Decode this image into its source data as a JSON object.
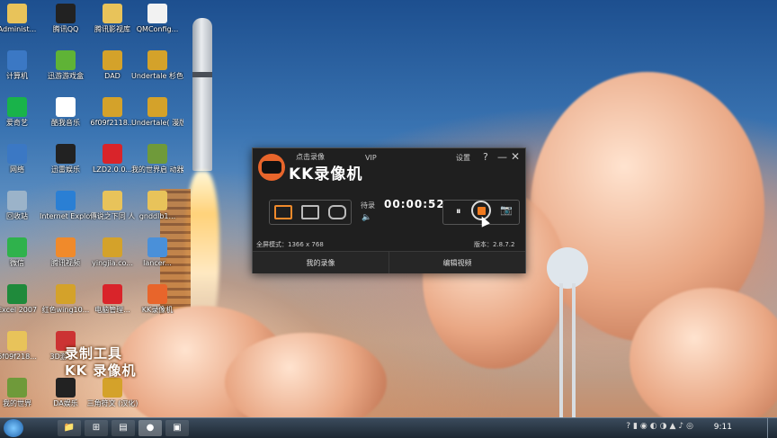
{
  "desktop_icons": [
    {
      "label": "Administ...",
      "icon": "folder-user-icon",
      "color": "#e8c35a"
    },
    {
      "label": "腾讯QQ",
      "icon": "qq-penguin-icon",
      "color": "#222222"
    },
    {
      "label": "腾讯影视库",
      "icon": "folder-icon",
      "color": "#e8c35a"
    },
    {
      "label": "QMConfig...",
      "icon": "file-icon",
      "color": "#f2f2f2"
    },
    {
      "label": "计算机",
      "icon": "computer-icon",
      "color": "#3b78c4"
    },
    {
      "label": "迅游游戏盒",
      "icon": "game-box-icon",
      "color": "#5fb336"
    },
    {
      "label": "DAD",
      "icon": "archive-icon",
      "color": "#d4a22a"
    },
    {
      "label": "Undertale\n杉色版（...",
      "icon": "archive-icon",
      "color": "#d4a22a"
    },
    {
      "label": "爱奇艺",
      "icon": "iqiyi-icon",
      "color": "#19b34a"
    },
    {
      "label": "酷我音乐",
      "icon": "kuwo-music-icon",
      "color": "#ffffff"
    },
    {
      "label": "6f09f2118...",
      "icon": "archive-icon",
      "color": "#d4a22a"
    },
    {
      "label": "Undertale(\n漫版)",
      "icon": "archive-icon",
      "color": "#d4a22a"
    },
    {
      "label": "网络",
      "icon": "network-icon",
      "color": "#3b78c4"
    },
    {
      "label": "迅雷娱乐",
      "icon": "game-icon",
      "color": "#222222"
    },
    {
      "label": "LZD2.0.0...",
      "icon": "app-red-icon",
      "color": "#d9242a"
    },
    {
      "label": "我的世界启\n动器",
      "icon": "minecraft-icon",
      "color": "#6f9a3a"
    },
    {
      "label": "回收站",
      "icon": "recycle-bin-icon",
      "color": "#9bb3c9"
    },
    {
      "label": "Internet\nExplorer",
      "icon": "ie-icon",
      "color": "#2a7fd4"
    },
    {
      "label": "傳说之下同\n人",
      "icon": "folder-icon",
      "color": "#e8c35a"
    },
    {
      "label": "gnddlb1...",
      "icon": "file-icon",
      "color": "#e8c35a"
    },
    {
      "label": "微信",
      "icon": "wechat-icon",
      "color": "#2fb24c"
    },
    {
      "label": "腾讯视频",
      "icon": "tencent-video-icon",
      "color": "#f08a2b"
    },
    {
      "label": "yingjia.co...",
      "icon": "archive-icon",
      "color": "#d4a22a"
    },
    {
      "label": "lancer...",
      "icon": "archive-icon",
      "color": "#4a90d9"
    },
    {
      "label": "Excel 2007",
      "icon": "excel-icon",
      "color": "#1f8a3b"
    },
    {
      "label": "红色wing10...",
      "icon": "archive-icon",
      "color": "#d4a22a"
    },
    {
      "label": "电脑管理...",
      "icon": "app-red-icon",
      "color": "#d9242a"
    },
    {
      "label": "KK录像机",
      "icon": "kk-icon",
      "color": "#e8652b"
    },
    {
      "label": "6f09f218...",
      "icon": "folder-icon",
      "color": "#e8c35a"
    },
    {
      "label": "3D游戏...",
      "icon": "app-icon",
      "color": "#cc3333"
    },
    {
      "label": "我的世界",
      "icon": "minecraft-icon",
      "color": "#6f9a3a"
    },
    {
      "label": "DA娱乐",
      "icon": "game-icon",
      "color": "#222222"
    },
    {
      "label": "三角符文\n(汉化)",
      "icon": "archive-icon",
      "color": "#d4a22a"
    }
  ],
  "overlay": {
    "line1": "录制工具",
    "line2": "KK 录像机"
  },
  "kk_window": {
    "title": "KK录像机",
    "record_label": "点击录像",
    "vip": "VIP",
    "settings": "设置",
    "help": "?",
    "minimize": "—",
    "close": "✕",
    "status": "待录",
    "timer": "00:00:52",
    "mode_info": "全屏模式：1366 x 768",
    "version": "版本：2.8.7.2",
    "tab_my_videos": "我的录像",
    "tab_edit_video": "编辑视频",
    "icons": {
      "pause": "⏸",
      "camera": "📷",
      "volume": "🔈"
    }
  },
  "taskbar": {
    "clock": "9:11",
    "tray_icons": "?▮◉◐◑▲♪◎",
    "buttons": [
      "📁",
      "⊞",
      "▤",
      "●",
      "▣"
    ]
  }
}
